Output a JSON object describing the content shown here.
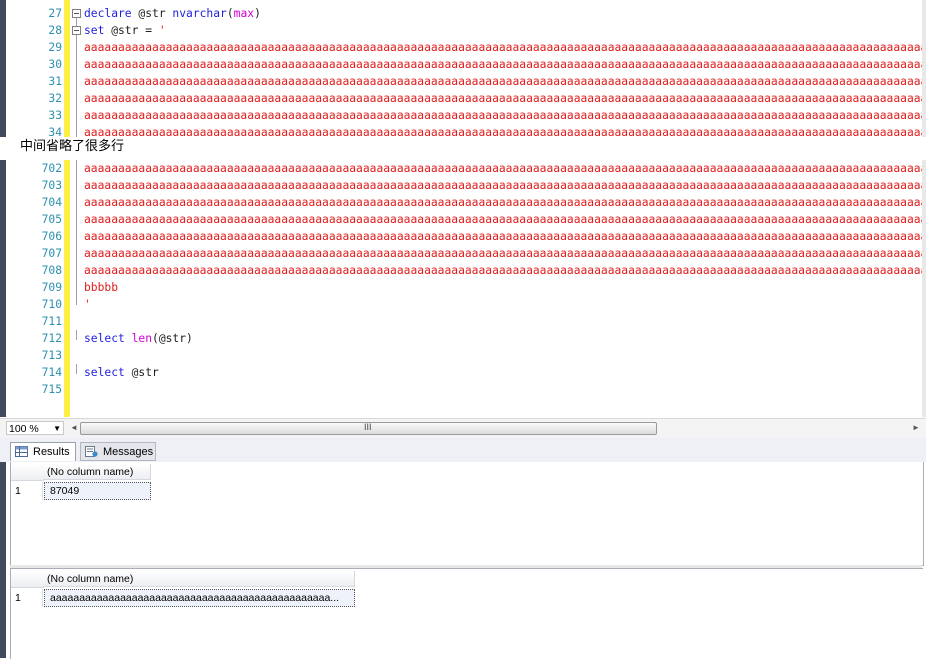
{
  "editor_top": {
    "lines": [
      {
        "num": "27",
        "tokens": [
          {
            "t": "declare",
            "c": "kw"
          },
          {
            "t": " @str ",
            "c": "plain"
          },
          {
            "t": "nvarchar",
            "c": "kw"
          },
          {
            "t": "(",
            "c": "plain"
          },
          {
            "t": "max",
            "c": "fn"
          },
          {
            "t": ")",
            "c": "plain"
          }
        ],
        "fold": true
      },
      {
        "num": "28",
        "tokens": [
          {
            "t": "set",
            "c": "kw"
          },
          {
            "t": " @str = ",
            "c": "plain"
          },
          {
            "t": "'",
            "c": "str"
          }
        ],
        "fold": true
      },
      {
        "num": "29",
        "tokens": [
          {
            "t": "aaaaaaaaaaaaaaaaaaaaaaaaaaaaaaaaaaaaaaaaaaaaaaaaaaaaaaaaaaaaaaaaaaaaaaaaaaaaaaaaaaaaaaaaaaaaaaaaaaaaaaaaaaaaaaaaaaaaaaaaaaaaaaaaaaaaaaaaaaa",
            "c": "str"
          }
        ]
      },
      {
        "num": "30",
        "tokens": [
          {
            "t": "aaaaaaaaaaaaaaaaaaaaaaaaaaaaaaaaaaaaaaaaaaaaaaaaaaaaaaaaaaaaaaaaaaaaaaaaaaaaaaaaaaaaaaaaaaaaaaaaaaaaaaaaaaaaaaaaaaaaaaaaaaaaaaaaaaaaaaaaaaa",
            "c": "str"
          }
        ]
      },
      {
        "num": "31",
        "tokens": [
          {
            "t": "aaaaaaaaaaaaaaaaaaaaaaaaaaaaaaaaaaaaaaaaaaaaaaaaaaaaaaaaaaaaaaaaaaaaaaaaaaaaaaaaaaaaaaaaaaaaaaaaaaaaaaaaaaaaaaaaaaaaaaaaaaaaaaaaaaaaaaaaaaa",
            "c": "str"
          }
        ]
      },
      {
        "num": "32",
        "tokens": [
          {
            "t": "aaaaaaaaaaaaaaaaaaaaaaaaaaaaaaaaaaaaaaaaaaaaaaaaaaaaaaaaaaaaaaaaaaaaaaaaaaaaaaaaaaaaaaaaaaaaaaaaaaaaaaaaaaaaaaaaaaaaaaaaaaaaaaaaaaaaaaaaaaa",
            "c": "str"
          }
        ]
      },
      {
        "num": "33",
        "tokens": [
          {
            "t": "aaaaaaaaaaaaaaaaaaaaaaaaaaaaaaaaaaaaaaaaaaaaaaaaaaaaaaaaaaaaaaaaaaaaaaaaaaaaaaaaaaaaaaaaaaaaaaaaaaaaaaaaaaaaaaaaaaaaaaaaaaaaaaaaaaaaaaaaaaa",
            "c": "str"
          }
        ]
      },
      {
        "num": "34",
        "tokens": [
          {
            "t": "aaaaaaaaaaaaaaaaaaaaaaaaaaaaaaaaaaaaaaaaaaaaaaaaaaaaaaaaaaaaaaaaaaaaaaaaaaaaaaaaaaaaaaaaaaaaaaaaaaaaaaaaaaaaaaaaaaaaaaaaaaaaaaaaaaaaaaaaaaa",
            "c": "str"
          }
        ]
      }
    ]
  },
  "omission_note": "中间省略了很多行",
  "editor_bottom": {
    "lines": [
      {
        "num": "702",
        "tokens": [
          {
            "t": "aaaaaaaaaaaaaaaaaaaaaaaaaaaaaaaaaaaaaaaaaaaaaaaaaaaaaaaaaaaaaaaaaaaaaaaaaaaaaaaaaaaaaaaaaaaaaaaaaaaaaaaaaaaaaaaaaaaaaaaaaaaaaaaaaaaaaaaaaaa",
            "c": "str"
          }
        ]
      },
      {
        "num": "703",
        "tokens": [
          {
            "t": "aaaaaaaaaaaaaaaaaaaaaaaaaaaaaaaaaaaaaaaaaaaaaaaaaaaaaaaaaaaaaaaaaaaaaaaaaaaaaaaaaaaaaaaaaaaaaaaaaaaaaaaaaaaaaaaaaaaaaaaaaaaaaaaaaaaaaaaaaaa",
            "c": "str"
          }
        ]
      },
      {
        "num": "704",
        "tokens": [
          {
            "t": "aaaaaaaaaaaaaaaaaaaaaaaaaaaaaaaaaaaaaaaaaaaaaaaaaaaaaaaaaaaaaaaaaaaaaaaaaaaaaaaaaaaaaaaaaaaaaaaaaaaaaaaaaaaaaaaaaaaaaaaaaaaaaaaaaaaaaaaaaaa",
            "c": "str"
          }
        ]
      },
      {
        "num": "705",
        "tokens": [
          {
            "t": "aaaaaaaaaaaaaaaaaaaaaaaaaaaaaaaaaaaaaaaaaaaaaaaaaaaaaaaaaaaaaaaaaaaaaaaaaaaaaaaaaaaaaaaaaaaaaaaaaaaaaaaaaaaaaaaaaaaaaaaaaaaaaaaaaaaaaaaaaaa",
            "c": "str"
          }
        ]
      },
      {
        "num": "706",
        "tokens": [
          {
            "t": "aaaaaaaaaaaaaaaaaaaaaaaaaaaaaaaaaaaaaaaaaaaaaaaaaaaaaaaaaaaaaaaaaaaaaaaaaaaaaaaaaaaaaaaaaaaaaaaaaaaaaaaaaaaaaaaaaaaaaaaaaaaaaaaaaaaaaaaaaaa",
            "c": "str"
          }
        ]
      },
      {
        "num": "707",
        "tokens": [
          {
            "t": "aaaaaaaaaaaaaaaaaaaaaaaaaaaaaaaaaaaaaaaaaaaaaaaaaaaaaaaaaaaaaaaaaaaaaaaaaaaaaaaaaaaaaaaaaaaaaaaaaaaaaaaaaaaaaaaaaaaaaaaaaaaaaaaaaaaaaaaaaaa",
            "c": "str"
          }
        ]
      },
      {
        "num": "708",
        "tokens": [
          {
            "t": "aaaaaaaaaaaaaaaaaaaaaaaaaaaaaaaaaaaaaaaaaaaaaaaaaaaaaaaaaaaaaaaaaaaaaaaaaaaaaaaaaaaaaaaaaaaaaaaaaaaaaaaaaaaaaaaaaaaaaaaaaaaaaaaaaaaaaaaaaaa",
            "c": "str"
          }
        ]
      },
      {
        "num": "709",
        "tokens": [
          {
            "t": "bbbbb",
            "c": "str"
          }
        ]
      },
      {
        "num": "710",
        "tokens": [
          {
            "t": "'",
            "c": "str"
          }
        ]
      },
      {
        "num": "711",
        "tokens": []
      },
      {
        "num": "712",
        "tokens": [
          {
            "t": "select",
            "c": "kw"
          },
          {
            "t": " ",
            "c": "plain"
          },
          {
            "t": "len",
            "c": "fn"
          },
          {
            "t": "(@str)",
            "c": "plain"
          }
        ]
      },
      {
        "num": "713",
        "tokens": []
      },
      {
        "num": "714",
        "tokens": [
          {
            "t": "select",
            "c": "kw"
          },
          {
            "t": " @str",
            "c": "plain"
          }
        ]
      },
      {
        "num": "715",
        "tokens": []
      }
    ]
  },
  "zoom": {
    "value": "100 %"
  },
  "scrollbar": {
    "grip": "III",
    "left_arrow": "◄",
    "right_arrow": "►"
  },
  "tabs": [
    {
      "label": "Results",
      "icon": "grid-icon",
      "selected": true
    },
    {
      "label": "Messages",
      "icon": "messages-icon",
      "selected": false
    }
  ],
  "results": [
    {
      "header": "(No column name)",
      "rows": [
        {
          "num": "1",
          "value": "87049"
        }
      ]
    },
    {
      "header": "(No column name)",
      "rows": [
        {
          "num": "1",
          "value": "aaaaaaaaaaaaaaaaaaaaaaaaaaaaaaaaaaaaaaaaaaaaaaaa..."
        }
      ]
    }
  ],
  "colors": {
    "keyword": "#1f1fdf",
    "function": "#d400d4",
    "string": "#e01e1e",
    "line_number": "#2b91af",
    "change_bar": "#ffee44"
  }
}
